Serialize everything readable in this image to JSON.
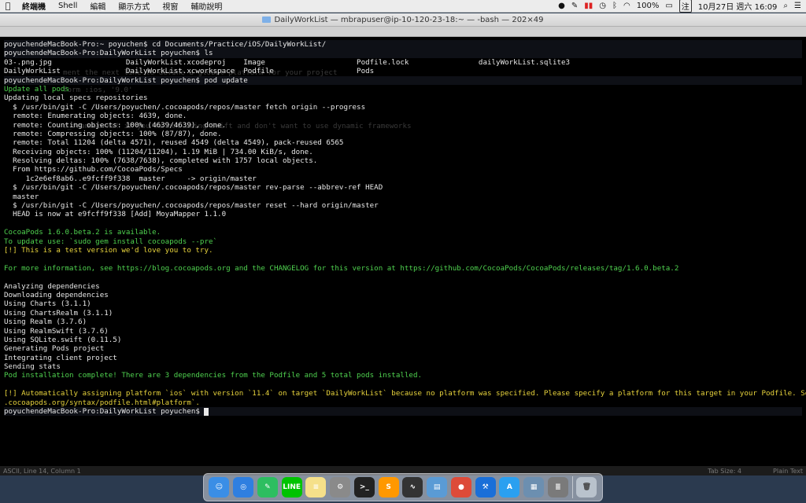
{
  "menubar": {
    "app_name": "終端機",
    "menus": [
      "Shell",
      "編輯",
      "顯示方式",
      "視窗",
      "輔助說明"
    ],
    "battery": "100%",
    "ime": "注",
    "datetime": "10月27日 週六 16:09"
  },
  "window": {
    "title": "DailyWorkList — mbrapuser@ip-10-120-23-18:~ — -bash — 202×49"
  },
  "terminal": {
    "lines": [
      {
        "text": "poyuchendeMacBook-Pro:~ poyuchen$ cd Documents/Practice/iOS/DailyWorkList/",
        "cls": "prompt"
      },
      {
        "text": "poyuchendeMacBook-Pro:DailyWorkList poyuchen$ ls",
        "cls": "prompt"
      },
      {
        "text": "03-.png.jpg                 DailyWorkList.xcodeproj    Image                     Podfile.lock                dailyWorkList.sqlite3",
        "cls": ""
      },
      {
        "text": "DailyWorkList               DailyWorkList.xcworkspace  Podfile                   Pods",
        "cls": ""
      },
      {
        "text": "poyuchendeMacBook-Pro:DailyWorkList poyuchen$ pod update",
        "cls": "prompt"
      },
      {
        "text": "Update all pods",
        "cls": "green"
      },
      {
        "text": "Updating local specs repositories",
        "cls": ""
      },
      {
        "text": "  $ /usr/bin/git -C /Users/poyuchen/.cocoapods/repos/master fetch origin --progress",
        "cls": ""
      },
      {
        "text": "  remote: Enumerating objects: 4639, done.",
        "cls": ""
      },
      {
        "text": "  remote: Counting objects: 100% (4639/4639), done.",
        "cls": ""
      },
      {
        "text": "  remote: Compressing objects: 100% (87/87), done.",
        "cls": ""
      },
      {
        "text": "  remote: Total 11204 (delta 4571), reused 4549 (delta 4549), pack-reused 6565",
        "cls": ""
      },
      {
        "text": "  Receiving objects: 100% (11204/11204), 1.19 MiB | 734.00 KiB/s, done.",
        "cls": ""
      },
      {
        "text": "  Resolving deltas: 100% (7638/7638), completed with 1757 local objects.",
        "cls": ""
      },
      {
        "text": "  From https://github.com/CocoaPods/Specs",
        "cls": ""
      },
      {
        "text": "     1c2e6ef8ab6..e9fcff9f338  master     -> origin/master",
        "cls": ""
      },
      {
        "text": "  $ /usr/bin/git -C /Users/poyuchen/.cocoapods/repos/master rev-parse --abbrev-ref HEAD",
        "cls": ""
      },
      {
        "text": "  master",
        "cls": ""
      },
      {
        "text": "  $ /usr/bin/git -C /Users/poyuchen/.cocoapods/repos/master reset --hard origin/master",
        "cls": ""
      },
      {
        "text": "  HEAD is now at e9fcff9f338 [Add] MoyaMapper 1.1.0",
        "cls": ""
      },
      {
        "text": "",
        "cls": ""
      },
      {
        "text": "CocoaPods 1.6.0.beta.2 is available.",
        "cls": "green"
      },
      {
        "text": "To update use: `sudo gem install cocoapods --pre`",
        "cls": "green"
      },
      {
        "text": "[!] This is a test version we'd love you to try.",
        "cls": "yellow"
      },
      {
        "text": "",
        "cls": ""
      },
      {
        "text": "For more information, see https://blog.cocoapods.org and the CHANGELOG for this version at https://github.com/CocoaPods/CocoaPods/releases/tag/1.6.0.beta.2",
        "cls": "green"
      },
      {
        "text": "",
        "cls": ""
      },
      {
        "text": "Analyzing dependencies",
        "cls": ""
      },
      {
        "text": "Downloading dependencies",
        "cls": ""
      },
      {
        "text": "Using Charts (3.1.1)",
        "cls": ""
      },
      {
        "text": "Using ChartsRealm (3.1.1)",
        "cls": ""
      },
      {
        "text": "Using Realm (3.7.6)",
        "cls": ""
      },
      {
        "text": "Using RealmSwift (3.7.6)",
        "cls": ""
      },
      {
        "text": "Using SQLite.swift (0.11.5)",
        "cls": ""
      },
      {
        "text": "Generating Pods project",
        "cls": ""
      },
      {
        "text": "Integrating client project",
        "cls": ""
      },
      {
        "text": "Sending stats",
        "cls": ""
      },
      {
        "text": "Pod installation complete! There are 3 dependencies from the Podfile and 5 total pods installed.",
        "cls": "green"
      },
      {
        "text": "",
        "cls": ""
      },
      {
        "text": "[!] Automatically assigning platform `ios` with version `11.4` on target `DailyWorkList` because no platform was specified. Please specify a platform for this target in your Podfile. See `https://guides",
        "cls": "yellow"
      },
      {
        "text": ".cocoapods.org/syntax/podfile.html#platform`.",
        "cls": "yellow"
      },
      {
        "text": "poyuchendeMacBook-Pro:DailyWorkList poyuchen$ ",
        "cls": "prompt cursorline"
      }
    ],
    "ghost": {
      "line1": "ment the next line to define a global platform for your project",
      "line2": "form :ios, '9.0'",
      "line3": "e_frameworks! if you're not using Swift and don't want to use dynamic frameworks"
    }
  },
  "statusbar": {
    "left": "ASCII, Line 14, Column 1",
    "tab_size": "Tab Size: 4",
    "syntax": "Plain Text"
  },
  "dock": {
    "apps": [
      {
        "name": "finder-icon",
        "color": "#3a8ee6",
        "glyph": "☺"
      },
      {
        "name": "safari-icon",
        "color": "#2f7fe0",
        "glyph": "◎"
      },
      {
        "name": "evernote-icon",
        "color": "#2dbe60",
        "glyph": "✎"
      },
      {
        "name": "line-icon",
        "color": "#00c300",
        "glyph": "LINE"
      },
      {
        "name": "notes-icon",
        "color": "#f5e08a",
        "glyph": "≡"
      },
      {
        "name": "system-preferences-icon",
        "color": "#8a8a8a",
        "glyph": "⚙"
      },
      {
        "name": "terminal-icon",
        "color": "#222222",
        "glyph": ">_"
      },
      {
        "name": "sublime-text-icon",
        "color": "#ff9800",
        "glyph": "S"
      },
      {
        "name": "activity-monitor-icon",
        "color": "#333333",
        "glyph": "∿"
      },
      {
        "name": "preview-icon",
        "color": "#5a9bd5",
        "glyph": "▤"
      },
      {
        "name": "chrome-icon",
        "color": "#dd4b39",
        "glyph": "●"
      },
      {
        "name": "xcode-icon",
        "color": "#1a6fd8",
        "glyph": "⚒"
      },
      {
        "name": "appstore-icon",
        "color": "#2aa0f0",
        "glyph": "A"
      },
      {
        "name": "image-viewer-icon",
        "color": "#6c8fb0",
        "glyph": "▦"
      },
      {
        "name": "database-icon",
        "color": "#7a7a7a",
        "glyph": "≣"
      }
    ],
    "trash": {
      "name": "trash-icon",
      "color": "#b9c2cc",
      "glyph": "🗑"
    }
  }
}
